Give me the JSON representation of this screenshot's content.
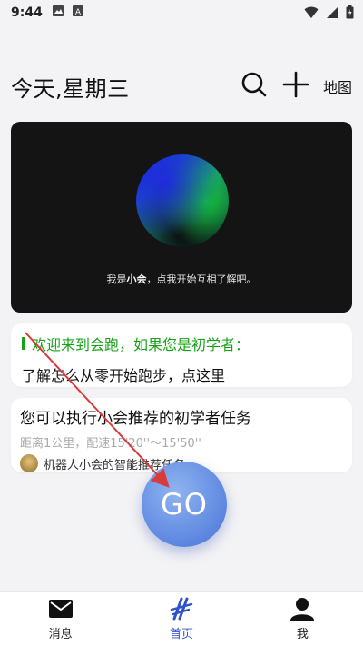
{
  "status_bar": {
    "time": "9:44",
    "icons": [
      "image-icon",
      "a-box-icon",
      "wifi-icon",
      "signal-icon",
      "battery-icon"
    ]
  },
  "header": {
    "title": "今天,星期三",
    "search_icon": "search-icon",
    "add_icon": "plus-icon",
    "map_label": "地图"
  },
  "hero": {
    "text_prefix": "我是",
    "text_name": "小会",
    "text_suffix": "，点我开始互相了解吧。"
  },
  "beginner_card": {
    "headline": "欢迎来到会跑，如果您是初学者：",
    "body": "了解怎么从零开始跑步，点这里"
  },
  "task_card": {
    "title": "您可以执行小会推荐的初学者任务",
    "details": "距离1公里，配速15'20''～15'50''",
    "source": "机器人小会的智能推荐任务"
  },
  "go_button": {
    "label": "GO"
  },
  "tabbar": {
    "items": [
      {
        "label": "消息",
        "icon": "mail-icon",
        "active": false
      },
      {
        "label": "首页",
        "icon": "home-logo-icon",
        "active": true
      },
      {
        "label": "我",
        "icon": "person-icon",
        "active": false
      }
    ]
  },
  "colors": {
    "accent_green": "#17a317",
    "tab_active": "#2e52c8",
    "go_blue": "#5d86e0",
    "arrow_red": "#d93a3a"
  }
}
